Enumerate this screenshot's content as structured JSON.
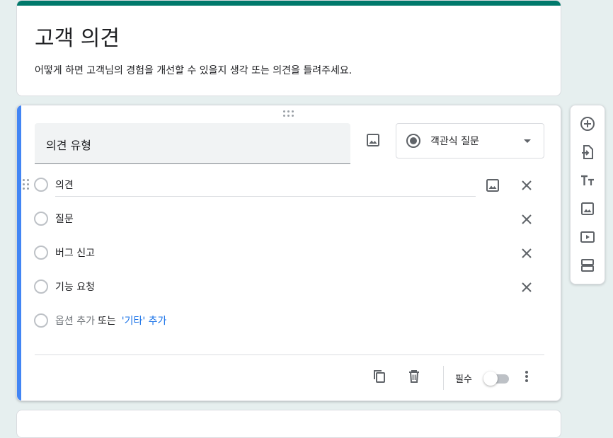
{
  "form": {
    "title": "고객 의견",
    "description": "어떻게 하면 고객님의 경험을 개선할 수 있을지 생각 또는 의견을 들려주세요."
  },
  "question": {
    "title": "의견 유형",
    "type_label": "객관식 질문",
    "options": [
      {
        "label": "의견"
      },
      {
        "label": "질문"
      },
      {
        "label": "버그 신고"
      },
      {
        "label": "기능 요청"
      }
    ],
    "add_option_label": "옵션 추가",
    "add_or_label": "또는",
    "add_other_label": "'기타' 추가",
    "required_label": "필수",
    "required": false
  },
  "colors": {
    "header_accent": "#00796b",
    "question_accent": "#4285f4",
    "background": "#e6efef",
    "link": "#1a73e8"
  },
  "icons": {
    "question_image": "image-icon",
    "option_image": "image-icon",
    "option_remove": "close-icon",
    "duplicate": "copy-icon",
    "delete": "trash-icon",
    "more": "more-vert-icon",
    "side_tools": [
      "add-circle-icon",
      "import-icon",
      "text-format-icon",
      "image-icon",
      "video-icon",
      "section-icon"
    ]
  }
}
